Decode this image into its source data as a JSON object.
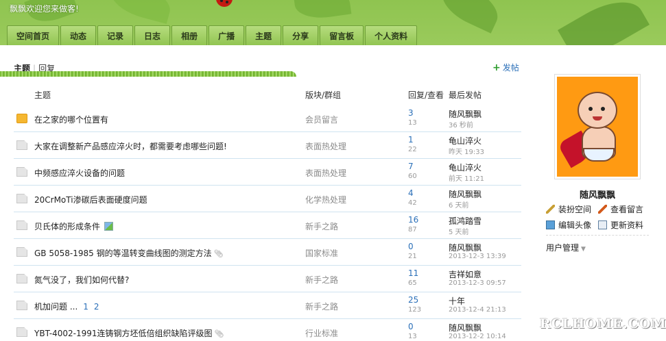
{
  "header": {
    "welcome": "飘飘欢迎您来做客!"
  },
  "nav": [
    {
      "label": "空间首页"
    },
    {
      "label": "动态"
    },
    {
      "label": "记录"
    },
    {
      "label": "日志"
    },
    {
      "label": "相册"
    },
    {
      "label": "广播"
    },
    {
      "label": "主题"
    },
    {
      "label": "分享"
    },
    {
      "label": "留言板"
    },
    {
      "label": "个人资料"
    }
  ],
  "tabs": {
    "active": "主题",
    "other": "回复",
    "post_link": "发帖"
  },
  "list": {
    "columns": {
      "topic": "主题",
      "forum": "版块/群组",
      "reply_view": "回复/查看",
      "last_post": "最后发帖"
    },
    "rows": [
      {
        "title": "在之家的哪个位置有",
        "forum": "会员留言",
        "replies": "3",
        "views": "13",
        "author": "随风飘飘",
        "time": "36 秒前",
        "hot": true
      },
      {
        "title": "大家在调整新产品感应淬火时，都需要考虑哪些问题!",
        "forum": "表面热处理",
        "replies": "1",
        "views": "22",
        "author": "龟山淬火",
        "time": "昨天 19:33"
      },
      {
        "title": "中频感应淬火设备的问题",
        "forum": "表面热处理",
        "replies": "7",
        "views": "60",
        "author": "龟山淬火",
        "time": "前天 11:21"
      },
      {
        "title": "20CrMoTi渗碳后表面硬度问题",
        "forum": "化学热处理",
        "replies": "4",
        "views": "42",
        "author": "随风飘飘",
        "time": "6 天前"
      },
      {
        "title": "贝氏体的形成条件",
        "forum": "新手之路",
        "replies": "16",
        "views": "87",
        "author": "孤鸿踏雪",
        "time": "5 天前",
        "has_image": true
      },
      {
        "title": "GB 5058-1985 钢的等温转变曲线图的测定方法",
        "forum": "国家标准",
        "replies": "0",
        "views": "21",
        "author": "随风飘飘",
        "time": "2013-12-3 13:39",
        "has_attachment": true
      },
      {
        "title": "氮气没了，我们如何代替?",
        "forum": "新手之路",
        "replies": "11",
        "views": "65",
        "author": "吉祥如意",
        "time": "2013-12-3 09:57"
      },
      {
        "title": "机加问题 ...",
        "pages": [
          "1",
          "2"
        ],
        "forum": "新手之路",
        "replies": "25",
        "views": "123",
        "author": "十年",
        "time": "2013-12-4 21:13"
      },
      {
        "title": "YBT-4002-1991连铸钢方坯低倍组织缺陷评级图",
        "forum": "行业标准",
        "replies": "0",
        "views": "13",
        "author": "随风飘飘",
        "time": "2013-12-2 10:14",
        "has_attachment": true
      }
    ]
  },
  "profile": {
    "name": "随风飘飘",
    "actions": {
      "decorate": "装扮空间",
      "view_messages": "查看留言",
      "edit_avatar": "编辑头像",
      "update_profile": "更新资料"
    },
    "user_mgmt": "用户管理"
  },
  "watermark": "RCLHOME.COM"
}
